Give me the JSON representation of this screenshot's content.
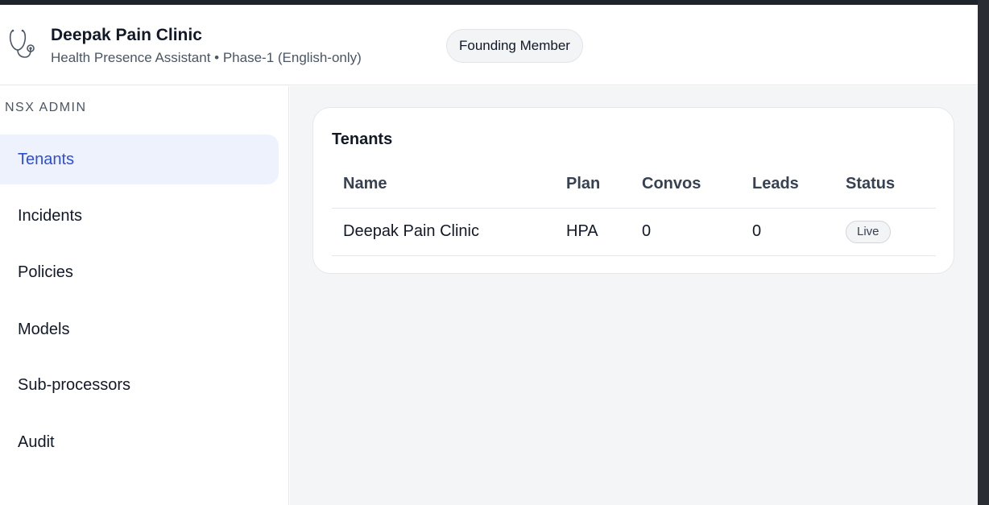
{
  "header": {
    "title": "Deepak Pain Clinic",
    "subtitle": "Health Presence Assistant • Phase-1 (English-only)",
    "badge": "Founding Member",
    "logo_icon": "stethoscope-icon"
  },
  "sidebar": {
    "heading": "NSX ADMIN",
    "items": [
      {
        "label": "Tenants",
        "active": true
      },
      {
        "label": "Incidents",
        "active": false
      },
      {
        "label": "Policies",
        "active": false
      },
      {
        "label": "Models",
        "active": false
      },
      {
        "label": "Sub-processors",
        "active": false
      },
      {
        "label": "Audit",
        "active": false
      }
    ]
  },
  "main": {
    "card": {
      "title": "Tenants",
      "columns": [
        "Name",
        "Plan",
        "Convos",
        "Leads",
        "Status"
      ],
      "rows": [
        {
          "name": "Deepak Pain Clinic",
          "plan": "HPA",
          "convos": "0",
          "leads": "0",
          "status": "Live"
        }
      ]
    }
  },
  "colors": {
    "accent": "#2f4ed8",
    "active_bg": "#eef2fd",
    "main_bg": "#f4f5f7"
  }
}
